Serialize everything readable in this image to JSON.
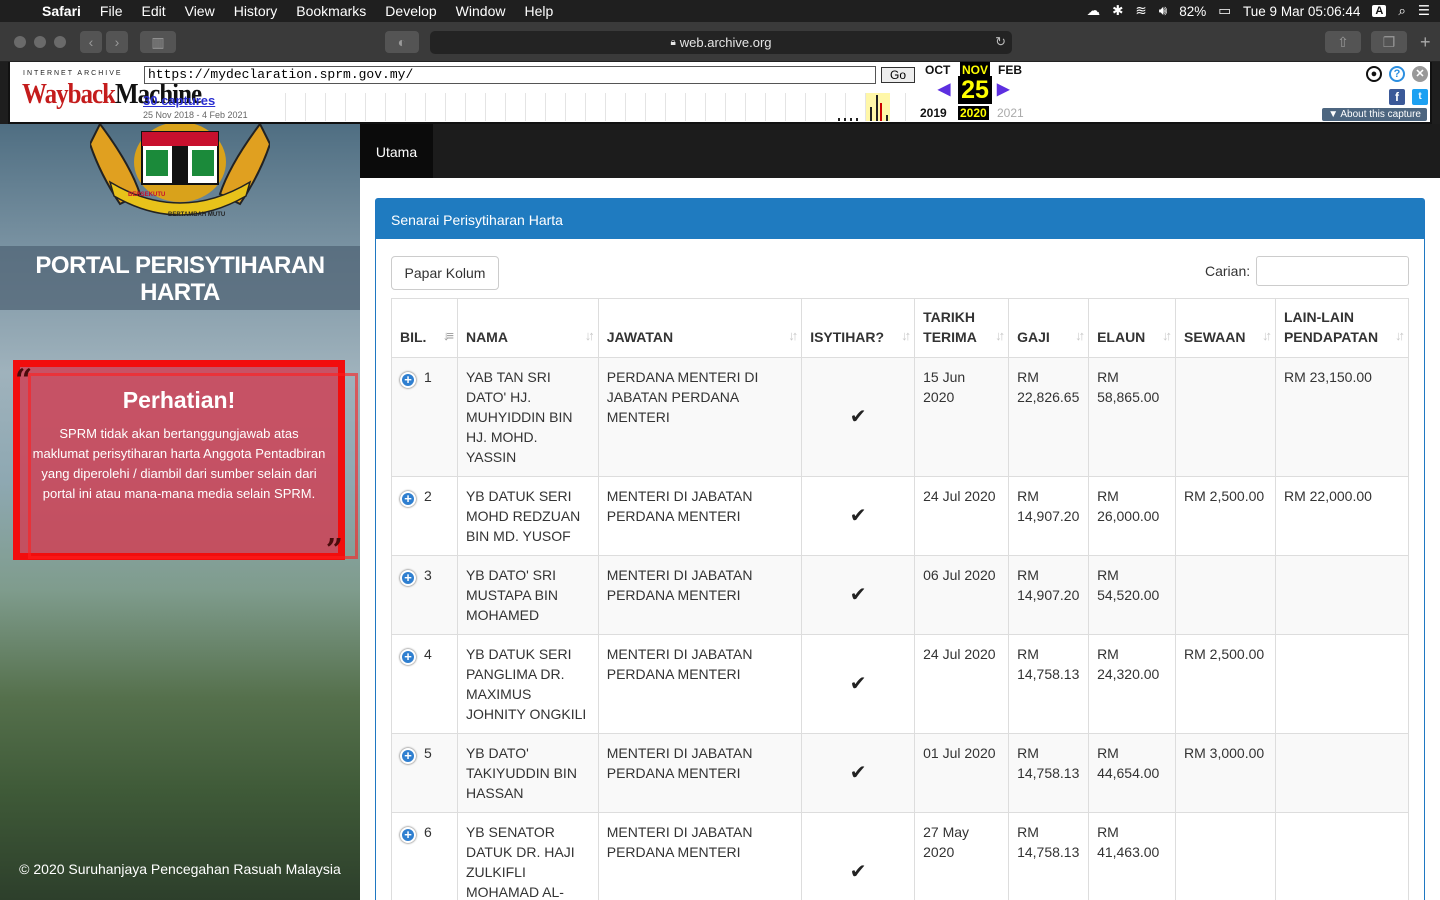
{
  "menubar": {
    "apple": "",
    "items": [
      "Safari",
      "File",
      "Edit",
      "View",
      "History",
      "Bookmarks",
      "Develop",
      "Window",
      "Help"
    ],
    "battery": "82%",
    "datetime": "Tue 9 Mar  05:06:44",
    "input_source": "A"
  },
  "browser": {
    "address": "web.archive.org"
  },
  "wayback": {
    "brand_small": "INTERNET ARCHIVE",
    "brand_logo_a": "Wayback",
    "brand_logo_b": "Machine",
    "url_value": "https://mydeclaration.sprm.gov.my/",
    "go_label": "Go",
    "captures": "30 captures",
    "range": "25 Nov 2018 - 4 Feb 2021",
    "month_prev": "OCT",
    "month_cur": "NOV",
    "month_next": "FEB",
    "day": "25",
    "year_prev": "2019",
    "year_cur": "2020",
    "year_next": "2021",
    "about": "About this capture"
  },
  "sidebar": {
    "crest_motto_left": "BERSEKUTU",
    "crest_motto_right": "BERTAMBAH MUTU",
    "portal_title": "PORTAL PERISYTIHARAN HARTA",
    "notice_title": "Perhatian!",
    "notice_text": "SPRM tidak akan bertanggungjawab atas maklumat perisytiharan harta Anggota Pentadbiran yang diperolehi / diambil dari sumber selain dari portal ini atau mana-mana media selain SPRM.",
    "copyright": "© 2020 Suruhanjaya Pencegahan Rasuah Malaysia"
  },
  "nav": {
    "tab": "Utama"
  },
  "panel": {
    "title": "Senarai Perisytiharan Harta",
    "column_button": "Papar Kolum",
    "search_label": "Carian:"
  },
  "table": {
    "headers": [
      "BIL.",
      "NAMA",
      "JAWATAN",
      "ISYTIHAR?",
      "TARIKH TERIMA",
      "GAJI",
      "ELAUN",
      "SEWAAN",
      "LAIN-LAIN PENDAPATAN"
    ],
    "rows": [
      {
        "bil": "1",
        "nama": "YAB TAN SRI DATO' HJ. MUHYIDDIN BIN HJ. MOHD. YASSIN",
        "jawatan": "PERDANA MENTERI DI JABATAN PERDANA MENTERI",
        "tarikh": "15 Jun 2020",
        "gaji": "RM 22,826.65",
        "elaun": "RM 58,865.00",
        "sewaan": "",
        "lain": "RM 23,150.00"
      },
      {
        "bil": "2",
        "nama": "YB DATUK SERI MOHD REDZUAN BIN MD. YUSOF",
        "jawatan": "MENTERI DI JABATAN PERDANA MENTERI",
        "tarikh": "24 Jul 2020",
        "gaji": "RM 14,907.20",
        "elaun": "RM 26,000.00",
        "sewaan": "RM 2,500.00",
        "lain": "RM 22,000.00"
      },
      {
        "bil": "3",
        "nama": "YB DATO' SRI MUSTAPA BIN MOHAMED",
        "jawatan": "MENTERI DI JABATAN PERDANA MENTERI",
        "tarikh": "06 Jul 2020",
        "gaji": "RM 14,907.20",
        "elaun": "RM 54,520.00",
        "sewaan": "",
        "lain": ""
      },
      {
        "bil": "4",
        "nama": "YB DATUK SERI PANGLIMA DR. MAXIMUS JOHNITY ONGKILI",
        "jawatan": "MENTERI DI JABATAN PERDANA MENTERI",
        "tarikh": "24 Jul 2020",
        "gaji": "RM 14,758.13",
        "elaun": "RM 24,320.00",
        "sewaan": "RM 2,500.00",
        "lain": ""
      },
      {
        "bil": "5",
        "nama": "YB DATO' TAKIYUDDIN BIN HASSAN",
        "jawatan": "MENTERI DI JABATAN PERDANA MENTERI",
        "tarikh": "01 Jul 2020",
        "gaji": "RM 14,758.13",
        "elaun": "RM 44,654.00",
        "sewaan": "RM 3,000.00",
        "lain": ""
      },
      {
        "bil": "6",
        "nama": "YB SENATOR DATUK DR. HAJI ZULKIFLI MOHAMAD AL-BAKRI",
        "jawatan": "MENTERI DI JABATAN PERDANA MENTERI",
        "tarikh": "27 May 2020",
        "gaji": "RM 14,758.13",
        "elaun": "RM 41,463.00",
        "sewaan": "",
        "lain": ""
      }
    ]
  }
}
